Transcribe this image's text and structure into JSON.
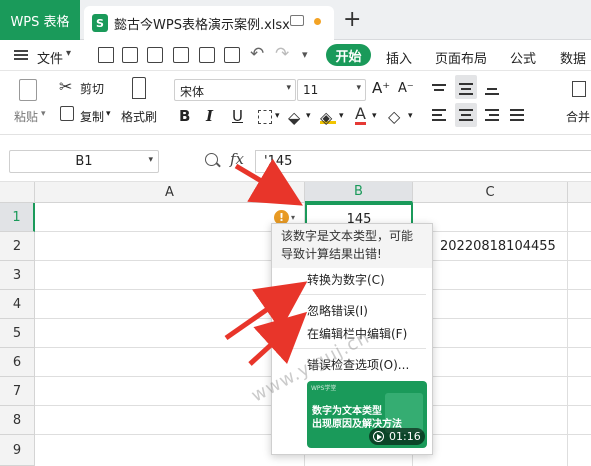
{
  "titlebar": {
    "app_tab": "WPS 表格",
    "doc_icon": "S",
    "doc_title": "懿古今WPS表格演示案例.xlsx",
    "new_tab": "+"
  },
  "menubar": {
    "file": "文件",
    "start": "开始",
    "items": [
      "插入",
      "页面布局",
      "公式",
      "数据"
    ]
  },
  "ribbon": {
    "paste": "粘贴",
    "cut": "剪切",
    "copy": "复制",
    "format_painter": "格式刷",
    "font_name": "宋体",
    "font_size": "11",
    "bold": "B",
    "italic": "I",
    "underline": "U",
    "font_grow": "A⁺",
    "font_shrink": "A⁻",
    "merge": "合并"
  },
  "formula_bar": {
    "name_box": "B1",
    "fx": "fx",
    "formula": "'145"
  },
  "grid": {
    "columns": [
      "A",
      "B",
      "C"
    ],
    "active_column": "B",
    "rows": [
      "1",
      "2",
      "3",
      "4",
      "5",
      "6",
      "7",
      "8",
      "9"
    ],
    "active_row": "1",
    "cell_b1": "145",
    "cell_c2": "20220818104455"
  },
  "error_popup": {
    "error_icon": "!",
    "message": "该数字是文本类型，可能导致计算结果出错!",
    "items": [
      "转换为数字(C)",
      "忽略错误(I)",
      "在编辑栏中编辑(F)",
      "错误检查选项(O)..."
    ],
    "video": {
      "brand": "WPS学堂",
      "title_line1": "数字为文本类型",
      "title_line2": "出现原因及解决方法",
      "duration": "01:16"
    }
  },
  "watermark": "www.yiguj.cn",
  "colors": {
    "accent_green": "#1a9a5a",
    "warning_orange": "#e89a24",
    "arrow_red": "#e8352a"
  }
}
